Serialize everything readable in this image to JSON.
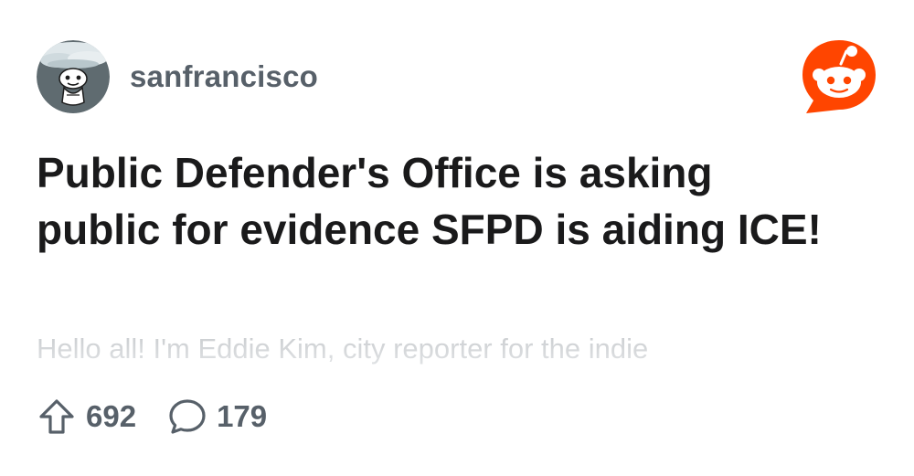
{
  "post": {
    "subreddit": "sanfrancisco",
    "title": "Public Defender's Office is asking public for evidence SFPD is aiding ICE!",
    "preview": "Hello all! I'm Eddie Kim, city reporter for the indie",
    "upvotes": "692",
    "comments": "179"
  },
  "icons": {
    "avatar": "subreddit-avatar-icon",
    "brand": "reddit-logo-icon",
    "upvote": "upvote-arrow-icon",
    "comment": "comment-bubble-icon"
  },
  "colors": {
    "brand": "#FF4500",
    "meta_text": "#576069",
    "title_text": "#1a1a1b"
  }
}
